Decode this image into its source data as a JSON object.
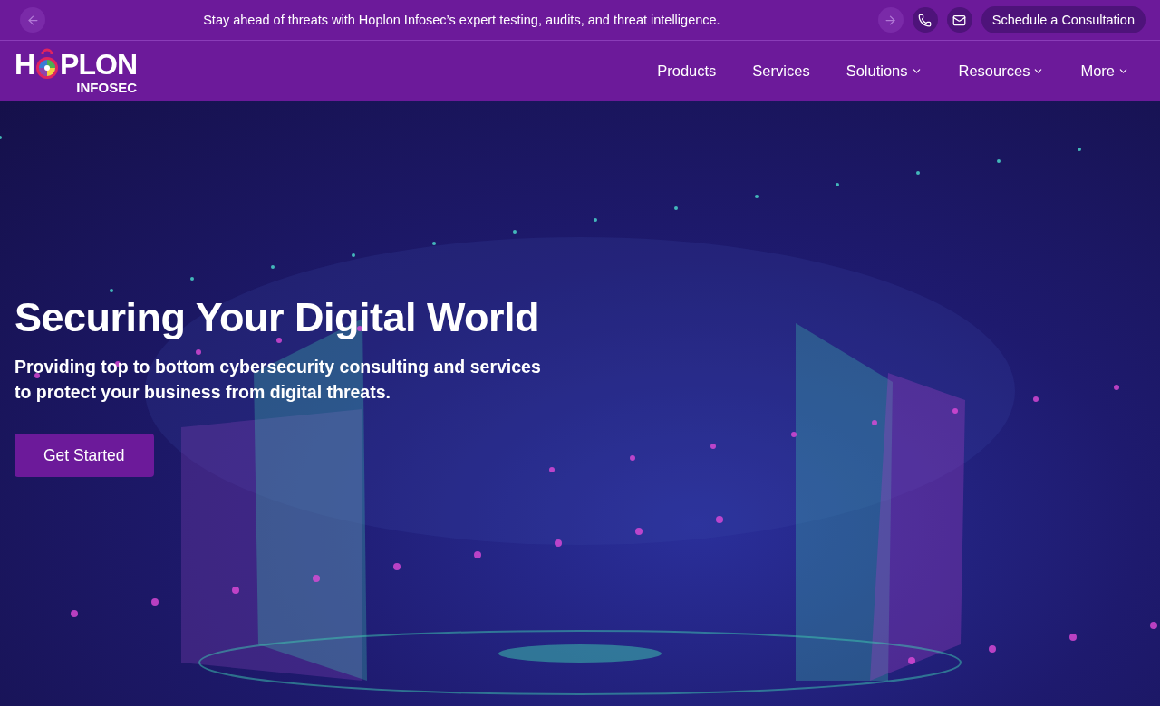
{
  "announcement": {
    "text": "Stay ahead of threats with Hoplon Infosec’s expert testing, audits, and threat intelligence.",
    "cta": "Schedule a Consultation"
  },
  "logo": {
    "before": "H",
    "after": "PLON",
    "sub": "INFOSEC"
  },
  "nav": [
    {
      "label": "Products",
      "has_menu": false
    },
    {
      "label": "Services",
      "has_menu": false
    },
    {
      "label": "Solutions",
      "has_menu": true
    },
    {
      "label": "Resources",
      "has_menu": true
    },
    {
      "label": "More",
      "has_menu": true
    }
  ],
  "hero": {
    "title": "Securing Your Digital World",
    "subtitle": "Providing top to bottom cybersecurity consulting and services to protect your business from digital threats.",
    "button": "Get Started"
  }
}
